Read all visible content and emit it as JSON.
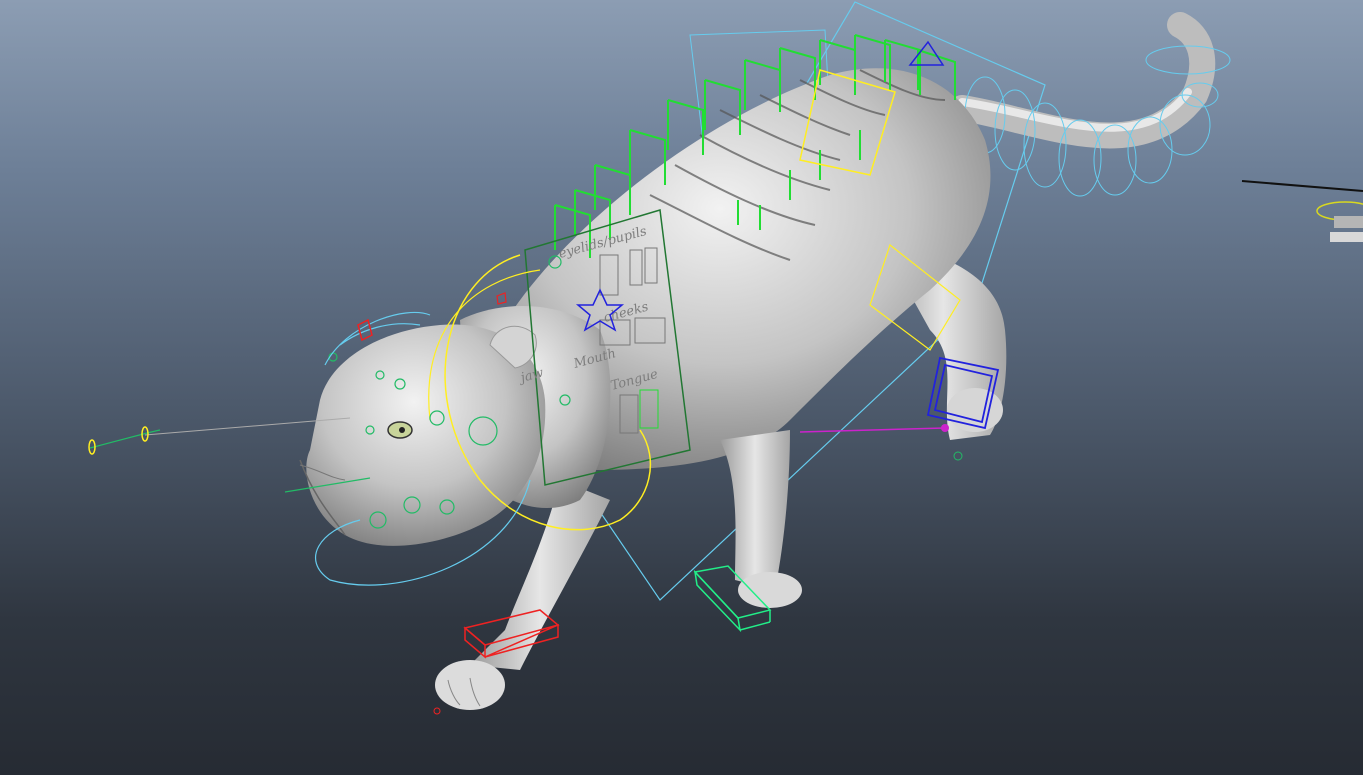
{
  "viewport": {
    "background_top": "#8c9db3",
    "background_bottom": "#262b33"
  },
  "face_panel": {
    "labels": {
      "eyelids": "eyelids/pupils",
      "cheeks": "cheeks",
      "jaw": "jaw",
      "mouth": "Mouth",
      "tongue": "Tongue"
    }
  },
  "colors": {
    "model": "#c8c8c8",
    "spine_controls": "#22dd33",
    "ik_planes": "#66ccee",
    "hip_control": "#ffee22",
    "fk_foot_right": "#ee2222",
    "fk_foot_left": "#22ee88",
    "hind_foot_control": "#2222dd",
    "pole_vector": "#cc22cc",
    "face_panel": "#227733"
  },
  "icons": [
    "star-control-icon",
    "triangle-control-icon",
    "circle-control-icon"
  ]
}
